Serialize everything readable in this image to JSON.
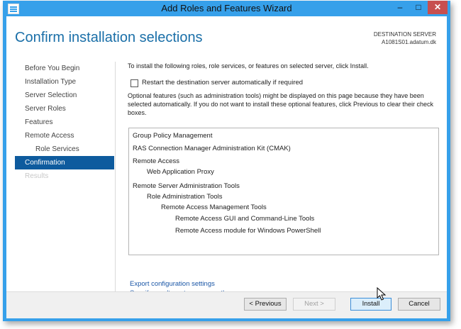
{
  "window": {
    "title": "Add Roles and Features Wizard",
    "controls": {
      "minimize": "–",
      "maximize": "□",
      "close": "✕"
    }
  },
  "header": {
    "page_title": "Confirm installation selections",
    "destination_label": "DESTINATION SERVER",
    "destination_value": "A1081S01.adatum.dk"
  },
  "nav": {
    "items": [
      {
        "label": "Before You Begin",
        "state": "normal"
      },
      {
        "label": "Installation Type",
        "state": "normal"
      },
      {
        "label": "Server Selection",
        "state": "normal"
      },
      {
        "label": "Server Roles",
        "state": "normal"
      },
      {
        "label": "Features",
        "state": "normal"
      },
      {
        "label": "Remote Access",
        "state": "normal"
      },
      {
        "label": "Role Services",
        "state": "indent"
      },
      {
        "label": "Confirmation",
        "state": "active"
      },
      {
        "label": "Results",
        "state": "disabled"
      }
    ]
  },
  "content": {
    "intro": "To install the following roles, role services, or features on selected server, click Install.",
    "restart_label": "Restart the destination server automatically if required",
    "restart_checked": false,
    "optional_note": "Optional features (such as administration tools) might be displayed on this page because they have been selected automatically. If you do not want to install these optional features, click Previous to clear their check boxes.",
    "features": [
      {
        "label": "Group Policy Management",
        "level": 0
      },
      {
        "label": "RAS Connection Manager Administration Kit (CMAK)",
        "level": 0
      },
      {
        "label": "Remote Access",
        "level": 0
      },
      {
        "label": "Web Application Proxy",
        "level": 1
      },
      {
        "label": "Remote Server Administration Tools",
        "level": 0
      },
      {
        "label": "Role Administration Tools",
        "level": 1
      },
      {
        "label": "Remote Access Management Tools",
        "level": 2
      },
      {
        "label": "Remote Access GUI and Command-Line Tools",
        "level": 3
      },
      {
        "label": "Remote Access module for Windows PowerShell",
        "level": 3
      }
    ],
    "links": {
      "export": "Export configuration settings",
      "alternate_source": "Specify an alternate source path"
    }
  },
  "footer": {
    "previous": "< Previous",
    "next": "Next >",
    "install": "Install",
    "cancel": "Cancel"
  },
  "colors": {
    "title_bar": "#36a0ea",
    "title_text": "#1a6fa8",
    "active_nav": "#0e5b9e",
    "link": "#1a56a6",
    "close_button": "#c74f4f"
  }
}
